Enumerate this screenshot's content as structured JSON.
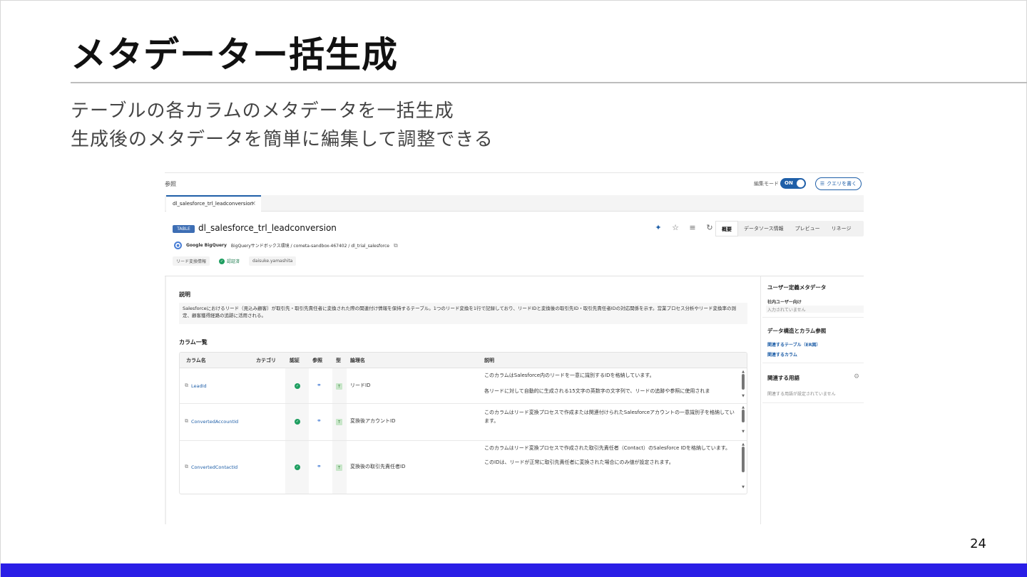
{
  "slide": {
    "title": "メタデーター括生成",
    "subtitle_1": "テーブルの各カラムのメタデータを一括生成",
    "subtitle_2": "生成後のメタデータを簡単に編集して調整できる",
    "page_number": "24",
    "accent_color": "#2a1ee6"
  },
  "app": {
    "breadcrumb": "参照",
    "edit_mode_label": "編集モード",
    "edit_mode_state": "ON",
    "query_button": "クエリを書く",
    "tab": {
      "label": "dl_salesforce_trl_leadconversion",
      "close": "×"
    },
    "badge": "TABLE",
    "table_name": "dl_salesforce_trl_leadconversion",
    "view_tabs": [
      "概要",
      "データソース情報",
      "プレビュー",
      "リネージ"
    ],
    "source": {
      "name": "Google BigQuery",
      "path": "BigQueryサンドボックス環境 / cometa-sandbox-467402 / dl_trial_salesforce"
    },
    "tags": {
      "category": "リード変換情報",
      "certified": "認証済",
      "owner": "daisuke.yamashita"
    },
    "description": {
      "label": "説明",
      "text": "Salesforceにおけるリード（見込み顧客）が取引先・取引先責任者に変換された際の関連付け情報を保持するテーブル。1つのリード変換を1行で記録しており、リードIDと変換後の取引先ID・取引先責任者IDの対応関係を示す。営業プロセス分析やリード変換率の測定、顧客獲得経路の追跡に活用される。"
    },
    "columns": {
      "label": "カラム一覧",
      "headers": {
        "name": "カラム名",
        "category": "カテゴリ",
        "certified": "認証",
        "reference": "参照",
        "type": "型",
        "logical_name": "論理名",
        "description": "説明"
      },
      "rows": [
        {
          "name": "LeadId",
          "logical_name": "リードID",
          "desc_1": "このカラムはSalesforce内のリードを一意に識別するIDを格納しています。",
          "desc_2": "各リードに対して自動的に生成される15文字の英数字の文字列で、リードの追跡や参照に使用されま"
        },
        {
          "name": "ConvertedAccountId",
          "logical_name": "変換後アカウントID",
          "desc_1": "このカラムはリード変換プロセスで作成または関連付けられたSalesforceアカウントの一意識別子を格納しています。",
          "desc_2": ""
        },
        {
          "name": "ConvertedContactId",
          "logical_name": "変換後の取引先責任者ID",
          "desc_1": "このカラムはリード変換プロセスで作成された取引先責任者（Contact）のSalesforce IDを格納しています。",
          "desc_2": "このIDは、リードが正常に取引先責任者に変換された場合にのみ値が設定されます。"
        }
      ],
      "type_badge": "T"
    },
    "sidebar": {
      "user_meta_title": "ユーザー定義メタデータ",
      "internal_label": "社内ユーザー向け",
      "internal_empty": "入力されていません",
      "structure_title": "データ構造とカラム参照",
      "related_tables": "関連するテーブル（ER図）",
      "related_columns": "関連するカラム",
      "terms_title": "関連する用語",
      "terms_empty": "関連する用語が設定されていません"
    }
  }
}
